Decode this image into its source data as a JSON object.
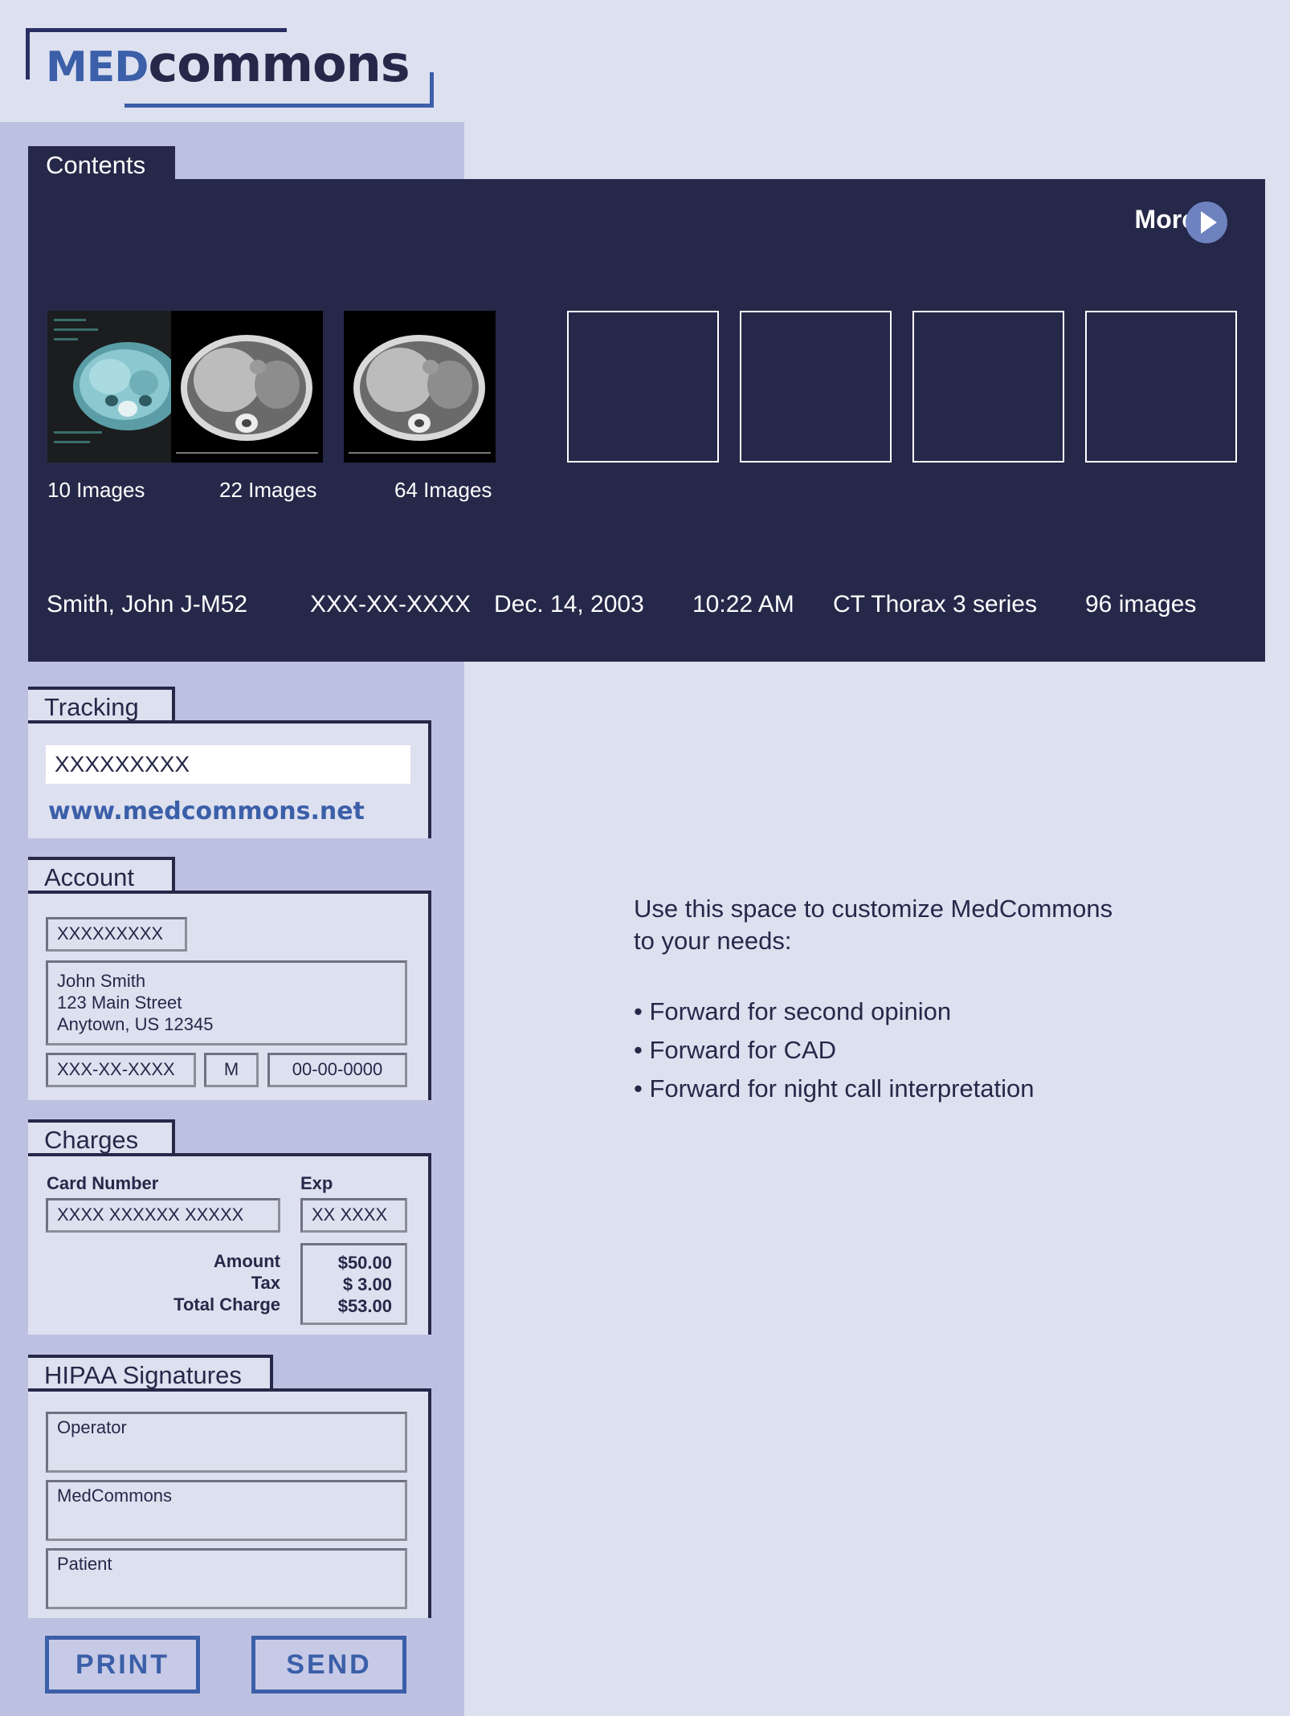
{
  "brand": {
    "med": "MED",
    "commons": "commons"
  },
  "contents": {
    "title": "Contents",
    "more_label": "More",
    "thumbnails": [
      {
        "label": "10 Images"
      },
      {
        "label": "22 Images"
      },
      {
        "label": "64 Images"
      }
    ],
    "patient": {
      "name": "Smith, John  J-M52",
      "ssn": "XXX-XX-XXXX",
      "date": "Dec. 14, 2003",
      "time": "10:22 AM",
      "study": "CT Thorax  3 series",
      "image_count": "96 images"
    }
  },
  "tracking": {
    "title": "Tracking",
    "number": "XXXXXXXXX",
    "website": "www.medcommons.net"
  },
  "account": {
    "title": "Account",
    "id": "XXXXXXXXX",
    "address_lines": [
      "John Smith",
      "123 Main Street",
      "Anytown, US 12345"
    ],
    "ssn": "XXX-XX-XXXX",
    "sex": "M",
    "dob": "00-00-0000"
  },
  "charges": {
    "title": "Charges",
    "card_label": "Card Number",
    "exp_label": "Exp",
    "card_number": "XXXX XXXXXX XXXXX",
    "exp": "XX XXXX",
    "amount_label": "Amount",
    "tax_label": "Tax",
    "total_label": "Total Charge",
    "amount": "$50.00",
    "tax": "$  3.00",
    "total": "$53.00"
  },
  "signatures": {
    "title": "HIPAA Signatures",
    "operator": "Operator",
    "medcommons": "MedCommons",
    "patient": "Patient"
  },
  "buttons": {
    "print": "PRINT",
    "send": "SEND"
  },
  "custom": {
    "intro_line1": "Use this space to customize MedCommons",
    "intro_line2": "to your needs:",
    "bullets": [
      "Forward for second opinion",
      "Forward for CAD",
      "Forward for night call interpretation"
    ]
  }
}
